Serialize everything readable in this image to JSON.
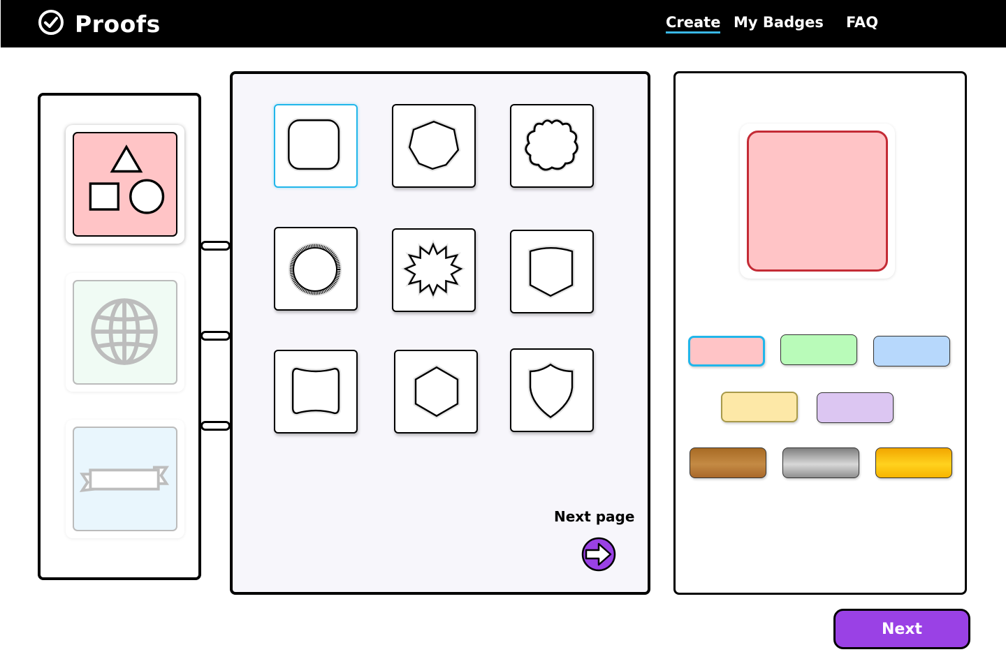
{
  "header": {
    "brand": "Proofs",
    "brand_icon": "check-circle-icon",
    "nav": [
      {
        "label": "Create",
        "active": true
      },
      {
        "label": "My Badges",
        "active": false
      },
      {
        "label": "FAQ",
        "active": false
      }
    ],
    "accent_color": "#39b8e6"
  },
  "categories": [
    {
      "name": "shapes",
      "icon": "shapes-icon",
      "selected": true,
      "bg": "#ffc4c6"
    },
    {
      "name": "globe",
      "icon": "globe-icon",
      "selected": false,
      "bg": "#f0fbf4"
    },
    {
      "name": "ribbon",
      "icon": "ribbon-icon",
      "selected": false,
      "bg": "#e9f6fd"
    }
  ],
  "shapes": [
    {
      "id": "rounded-square",
      "selected": true
    },
    {
      "id": "heptagon",
      "selected": false
    },
    {
      "id": "scalloped-flower",
      "selected": false
    },
    {
      "id": "serrated-circle",
      "selected": false
    },
    {
      "id": "starburst",
      "selected": false
    },
    {
      "id": "pointed-shield",
      "selected": false
    },
    {
      "id": "bracket-label",
      "selected": false
    },
    {
      "id": "hexagon",
      "selected": false
    },
    {
      "id": "shield",
      "selected": false
    }
  ],
  "pagination": {
    "next_page_label": "Next page",
    "next_page_icon": "arrow-right-icon"
  },
  "preview": {
    "fill": "#ffc4c6",
    "stroke": "#c42b35"
  },
  "colors": [
    {
      "name": "pink",
      "fill": "#ffc4c6",
      "selected": true
    },
    {
      "name": "green",
      "fill": "#b9fbb9",
      "selected": false
    },
    {
      "name": "blue",
      "fill": "#b7d8fc",
      "selected": false
    },
    {
      "name": "yellow",
      "fill": "#fde8a7",
      "border": "#a89a4a",
      "selected": false
    },
    {
      "name": "lavender",
      "fill": "#dcc6f2",
      "selected": false
    },
    {
      "name": "bronze",
      "gradient": "linear-gradient(180deg,#a86b24 0%,#c48a44 55%,#a9682a 100%)",
      "selected": false
    },
    {
      "name": "silver",
      "gradient": "linear-gradient(180deg,#7e7e7e 0%,#d8d8d8 55%,#8f8f8f 100%)",
      "selected": false
    },
    {
      "name": "gold",
      "gradient": "linear-gradient(180deg,#f2a600 0%,#ffd21e 55%,#f7b400 100%)",
      "selected": false
    }
  ],
  "actions": {
    "next_label": "Next",
    "next_color": "#9a41e5"
  }
}
